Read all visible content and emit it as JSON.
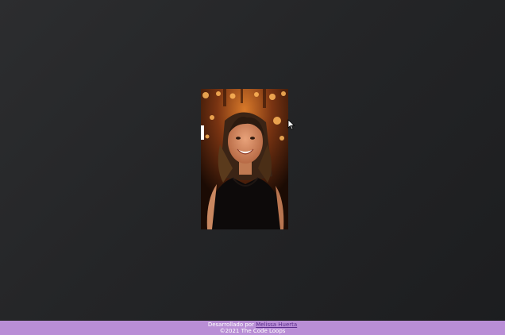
{
  "colors": {
    "background": "#242527",
    "footer_bg": "#b98ed6",
    "footer_text": "#ffffff",
    "link": "#5b2d8c"
  },
  "main": {
    "photo_icon": "portrait-photo"
  },
  "footer": {
    "developed_by_prefix": "Desarrollado por",
    "developer_name": "Melissa Huerta",
    "copyright": "©2021 The Code Loops"
  }
}
